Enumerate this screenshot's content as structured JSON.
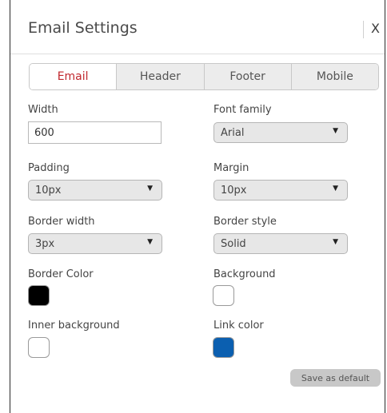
{
  "dialog": {
    "title": "Email Settings",
    "close_label": "X"
  },
  "tabs": [
    {
      "label": "Email",
      "active": true
    },
    {
      "label": "Header",
      "active": false
    },
    {
      "label": "Footer",
      "active": false
    },
    {
      "label": "Mobile",
      "active": false
    }
  ],
  "fields": {
    "width": {
      "label": "Width",
      "value": "600"
    },
    "font_family": {
      "label": "Font family",
      "value": "Arial"
    },
    "padding": {
      "label": "Padding",
      "value": "10px"
    },
    "margin": {
      "label": "Margin",
      "value": "10px"
    },
    "border_width": {
      "label": "Border width",
      "value": "3px"
    },
    "border_style": {
      "label": "Border style",
      "value": "Solid"
    },
    "border_color": {
      "label": "Border Color",
      "color": "#000000"
    },
    "background": {
      "label": "Background",
      "color": "#ffffff"
    },
    "inner_background": {
      "label": "Inner background",
      "color": "#ffffff"
    },
    "link_color": {
      "label": "Link color",
      "color": "#0b5fb0"
    }
  },
  "icons": {
    "dropdown": "triangle-down-icon"
  },
  "actions": {
    "save_default_label": "Save as default"
  }
}
